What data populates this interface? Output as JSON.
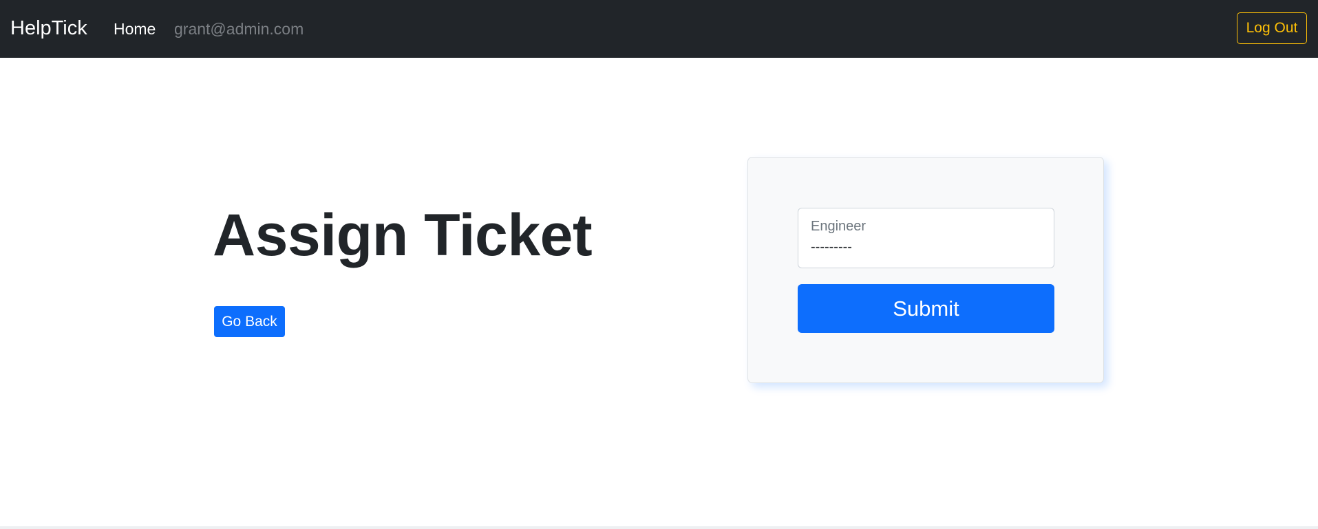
{
  "navbar": {
    "brand": "HelpTick",
    "home_label": "Home",
    "user_email": "grant@admin.com",
    "logout_label": "Log Out"
  },
  "main": {
    "title": "Assign Ticket",
    "go_back_label": "Go Back"
  },
  "form": {
    "engineer_label": "Engineer",
    "engineer_value": "---------",
    "submit_label": "Submit"
  },
  "colors": {
    "navbar_bg": "#212529",
    "primary": "#0d6efd",
    "warning": "#ffc107",
    "card_bg": "#f8f9fa"
  }
}
